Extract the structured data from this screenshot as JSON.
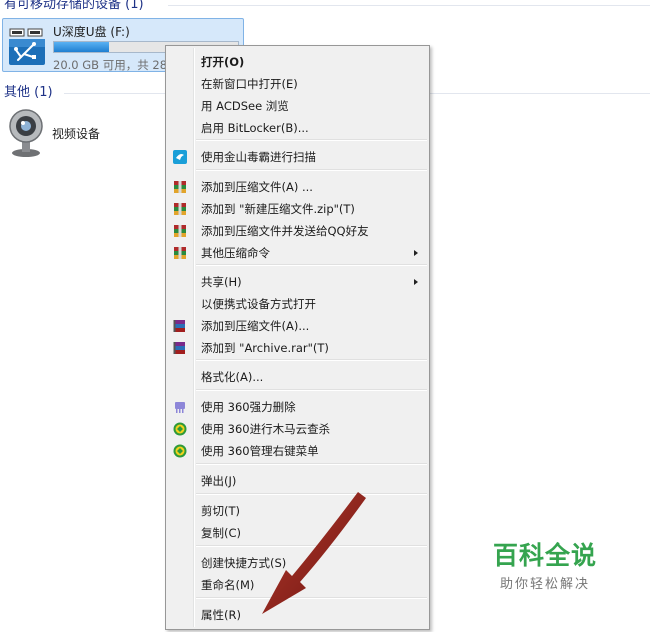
{
  "sections": {
    "removable": "有可移动存储的设备 (1)",
    "other": "其他 (1)"
  },
  "drive": {
    "name": "U深度U盘 (F:)",
    "capacity": "20.0 GB 可用，共 28.",
    "used_fraction": 0.3
  },
  "video_device": {
    "label": "视频设备"
  },
  "menu": {
    "items": [
      {
        "label": "打开(O)",
        "bold": true,
        "icon": ""
      },
      {
        "label": "在新窗口中打开(E)",
        "icon": ""
      },
      {
        "label": "用 ACDSee 浏览",
        "icon": ""
      },
      {
        "label": "启用 BitLocker(B)...",
        "icon": ""
      },
      {
        "label": "使用金山毒霸进行扫描",
        "icon": "kingsoft-antivirus-icon"
      },
      {
        "label": "添加到压缩文件(A) ...",
        "icon": "archive-icon"
      },
      {
        "label": "添加到 \"新建压缩文件.zip\"(T)",
        "icon": "archive-icon"
      },
      {
        "label": "添加到压缩文件并发送给QQ好友",
        "icon": "archive-icon"
      },
      {
        "label": "其他压缩命令",
        "icon": "archive-icon",
        "submenu": true
      },
      {
        "label": "共享(H)",
        "icon": "",
        "submenu": true
      },
      {
        "label": "以便携式设备方式打开",
        "icon": ""
      },
      {
        "label": "添加到压缩文件(A)...",
        "icon": "winrar-icon"
      },
      {
        "label": "添加到 \"Archive.rar\"(T)",
        "icon": "winrar-icon"
      },
      {
        "label": "格式化(A)...",
        "icon": ""
      },
      {
        "label": "使用 360强力删除",
        "icon": "360-shred-icon"
      },
      {
        "label": "使用 360进行木马云查杀",
        "icon": "360-safe-icon"
      },
      {
        "label": "使用 360管理右键菜单",
        "icon": "360-safe-icon"
      },
      {
        "label": "弹出(J)",
        "icon": ""
      },
      {
        "label": "剪切(T)",
        "icon": ""
      },
      {
        "label": "复制(C)",
        "icon": ""
      },
      {
        "label": "创建快捷方式(S)",
        "icon": ""
      },
      {
        "label": "重命名(M)",
        "icon": ""
      },
      {
        "label": "属性(R)",
        "icon": ""
      }
    ]
  },
  "watermark": {
    "title": "百科全说",
    "subtitle": "助你轻松解决"
  },
  "colors": {
    "menu_background": "#f0f0f0",
    "selection_tile": "#d6e8fa",
    "annotation_arrow": "#7a1410",
    "watermark_green": "#35a44f"
  }
}
